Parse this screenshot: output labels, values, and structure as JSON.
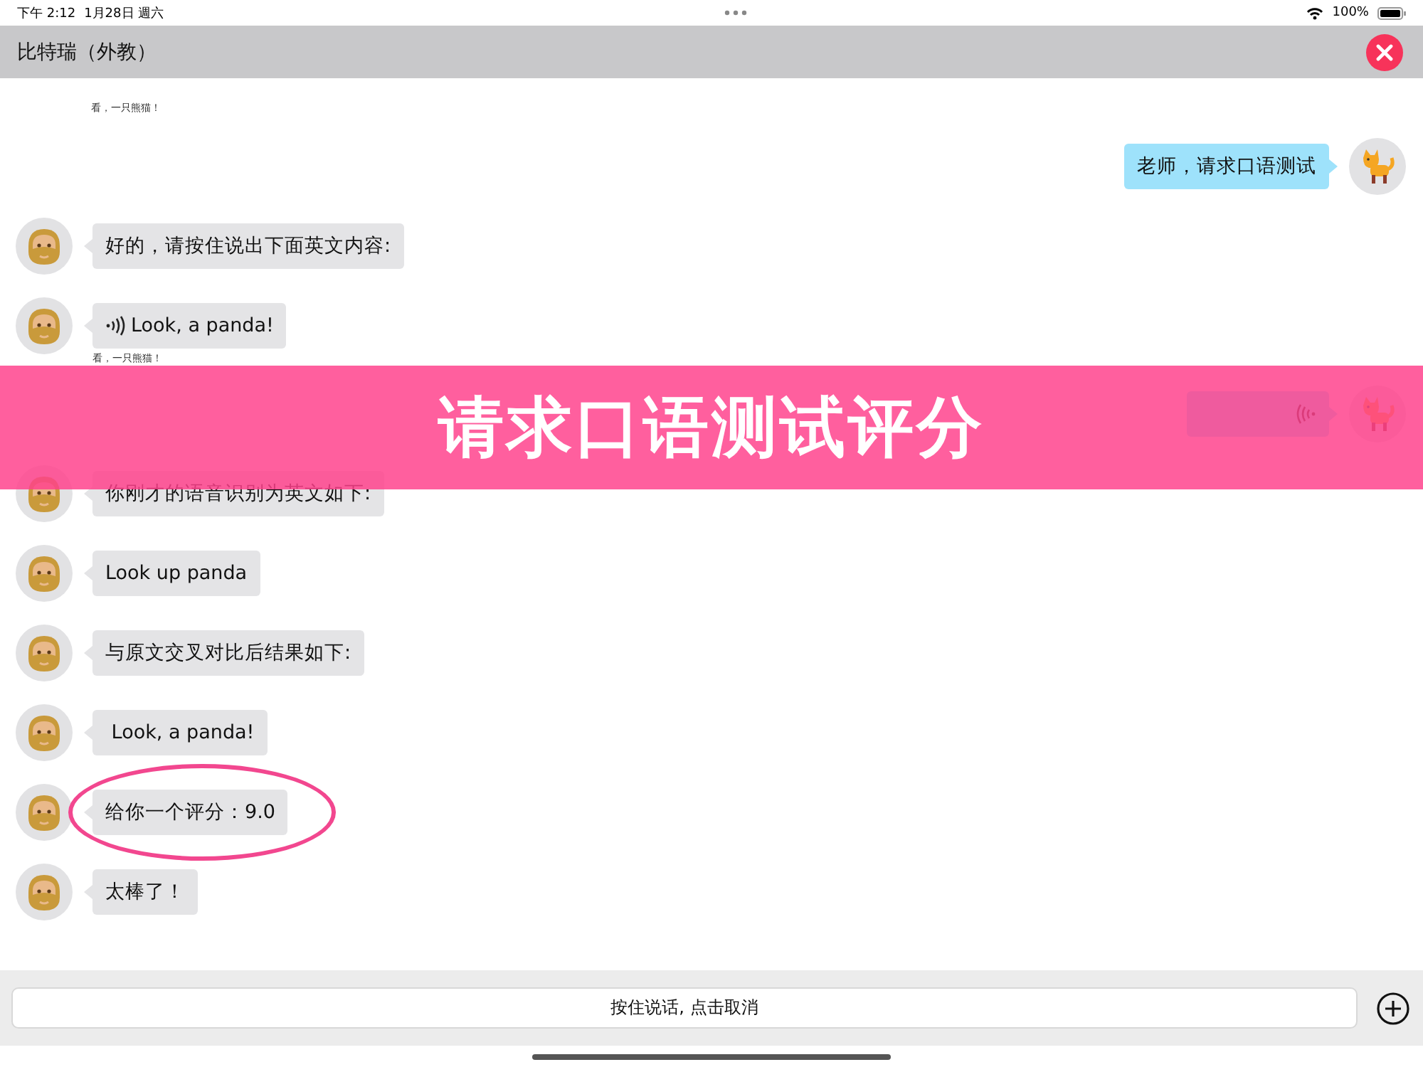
{
  "status_bar": {
    "time": "下午 2:12",
    "date": "1月28日 週六",
    "battery": "100%"
  },
  "header": {
    "title": "比特瑞（外教）"
  },
  "messages": [
    {
      "kind": "caption",
      "caption": "看，一只熊猫！"
    },
    {
      "outgoing": true,
      "kind": "text",
      "text": "老师，请求口语测试"
    },
    {
      "outgoing": false,
      "kind": "text",
      "text": "好的，请按住说出下面英文内容:"
    },
    {
      "outgoing": false,
      "kind": "voice",
      "text": "Look, a panda!",
      "caption": "看，一只熊猫！"
    },
    {
      "outgoing": true,
      "kind": "voice"
    },
    {
      "outgoing": false,
      "kind": "text",
      "text": "你刚才的语音识别为英文如下:"
    },
    {
      "outgoing": false,
      "kind": "text",
      "text": "Look up panda"
    },
    {
      "outgoing": false,
      "kind": "text",
      "text": "与原文交叉对比后结果如下:"
    },
    {
      "outgoing": false,
      "kind": "text",
      "text": " Look, a panda!"
    },
    {
      "outgoing": false,
      "kind": "text",
      "text": "给你一个评分：9.0",
      "circled": true
    },
    {
      "outgoing": false,
      "kind": "text",
      "text": "太棒了！"
    }
  ],
  "banner": {
    "text": "请求口语测试评分"
  },
  "input": {
    "label": "按住说话, 点击取消"
  }
}
